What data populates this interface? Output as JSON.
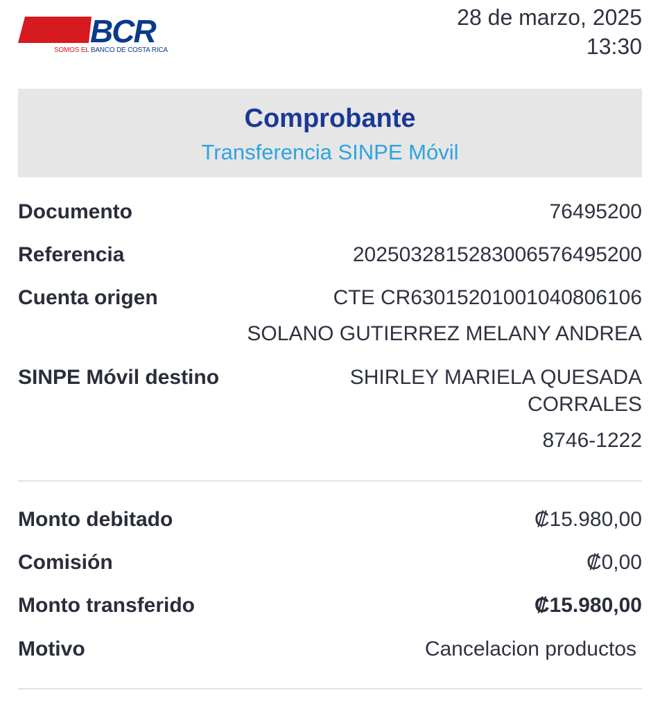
{
  "brand": {
    "logo_text": "BCR",
    "tagline_prefix": "SOMOS EL",
    "tagline_name": "BANCO DE COSTA RICA",
    "colors": {
      "red": "#d71920",
      "blue": "#0a3a8c"
    }
  },
  "header": {
    "date": "28 de marzo, 2025",
    "time": "13:30"
  },
  "banner": {
    "title": "Comprobante",
    "subtitle": "Transferencia SINPE Móvil"
  },
  "details": {
    "documento": {
      "label": "Documento",
      "value": "76495200"
    },
    "referencia": {
      "label": "Referencia",
      "value": "2025032815283006576495200"
    },
    "cuenta_origen": {
      "label": "Cuenta origen",
      "account": "CTE CR63015201001040806106",
      "holder": "SOLANO GUTIERREZ MELANY ANDREA"
    },
    "sinpe_destino": {
      "label": "SINPE Móvil destino",
      "name_line1": "SHIRLEY MARIELA QUESADA",
      "name_line2": "CORRALES",
      "phone": "8746-1222"
    }
  },
  "amounts": {
    "monto_debitado": {
      "label": "Monto debitado",
      "value": "₡15.980,00"
    },
    "comision": {
      "label": "Comisión",
      "value": "₡0,00"
    },
    "monto_transferido": {
      "label": "Monto transferido",
      "value": "₡15.980,00"
    },
    "motivo": {
      "label": "Motivo",
      "value": "Cancelacion productos"
    }
  },
  "colors": {
    "title_blue": "#1a3996",
    "subtitle_cyan": "#2ea3e0",
    "banner_bg": "#e6e6e6",
    "text": "#2a2d3a"
  }
}
